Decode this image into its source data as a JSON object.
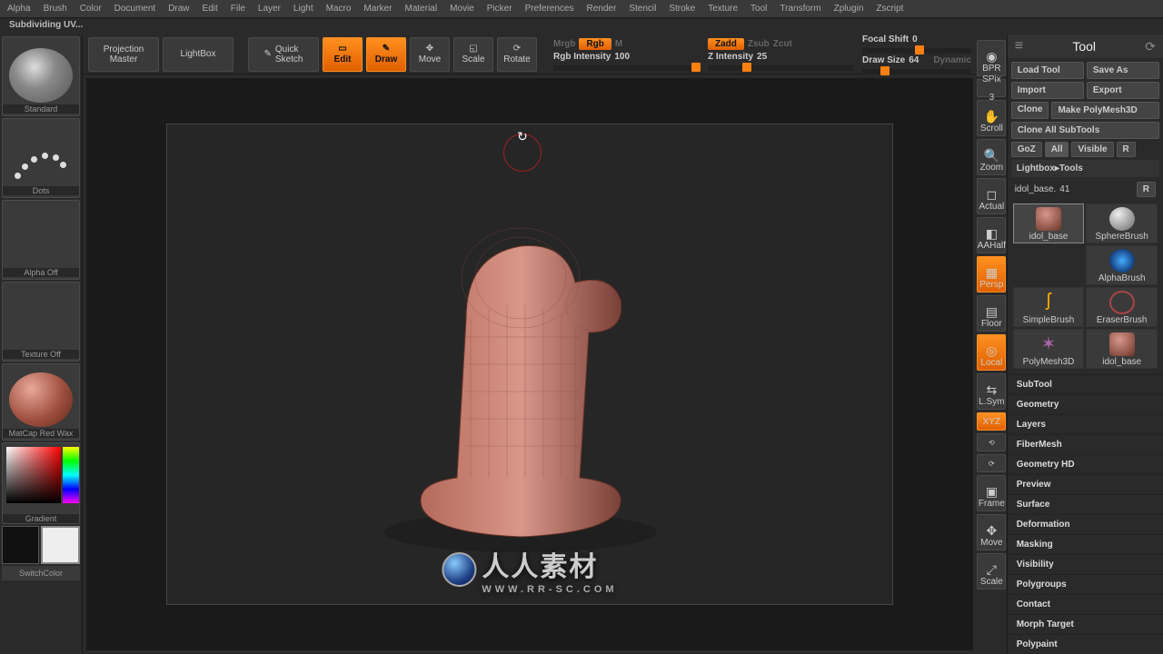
{
  "menu": [
    "Alpha",
    "Brush",
    "Color",
    "Document",
    "Draw",
    "Edit",
    "File",
    "Layer",
    "Light",
    "Macro",
    "Marker",
    "Material",
    "Movie",
    "Picker",
    "Preferences",
    "Render",
    "Stencil",
    "Stroke",
    "Texture",
    "Tool",
    "Transform",
    "Zplugin",
    "Zscript"
  ],
  "status_line": "Subdividing UV...",
  "top_btns": {
    "projection": "Projection\nMaster",
    "lightbox": "LightBox",
    "quicksketch": "Quick\nSketch"
  },
  "mode_btns": {
    "edit": "Edit",
    "draw": "Draw",
    "move": "Move",
    "scale": "Scale",
    "rotate": "Rotate"
  },
  "sliders": {
    "mrgb": "Mrgb",
    "rgb": "Rgb",
    "m": "M",
    "rgb_int_label": "Rgb Intensity",
    "rgb_int_val": "100",
    "zadd": "Zadd",
    "zsub": "Zsub",
    "zcut": "Zcut",
    "z_int_label": "Z Intensity",
    "z_int_val": "25",
    "focal_label": "Focal Shift",
    "focal_val": "0",
    "draw_label": "Draw Size",
    "draw_val": "64",
    "dynamic": "Dynamic"
  },
  "left": {
    "brush": "Standard",
    "stroke": "Dots",
    "alpha": "Alpha Off",
    "texture": "Texture Off",
    "material": "MatCap Red Wax",
    "gradient": "Gradient",
    "switchcolor": "SwitchColor"
  },
  "side": {
    "bpr": "BPR",
    "spix_label": "SPix",
    "spix_val": "3",
    "scroll": "Scroll",
    "zoom": "Zoom",
    "actual": "Actual",
    "aahalf": "AAHalf",
    "persp": "Persp",
    "floor": "Floor",
    "local": "Local",
    "lsym": "L.Sym",
    "xyz": "XYZ",
    "frame": "Frame",
    "move": "Move",
    "scale": "Scale"
  },
  "tool_panel": {
    "title": "Tool",
    "load": "Load Tool",
    "saveas": "Save As",
    "import": "Import",
    "export": "Export",
    "clone": "Clone",
    "makepoly": "Make PolyMesh3D",
    "cloneall": "Clone All SubTools",
    "goz": "GoZ",
    "all": "All",
    "visible": "Visible",
    "r": "R",
    "breadcrumb": "Lightbox▸Tools",
    "current": "idol_base.",
    "current_num": "41",
    "thumbs": [
      "idol_base",
      "SphereBrush",
      "AlphaBrush",
      "SimpleBrush",
      "EraserBrush",
      "PolyMesh3D",
      "idol_base"
    ],
    "sections": [
      "SubTool",
      "Geometry",
      "Layers",
      "FiberMesh",
      "Geometry HD",
      "Preview",
      "Surface",
      "Deformation",
      "Masking",
      "Visibility",
      "Polygroups",
      "Contact",
      "Morph Target",
      "Polypaint"
    ]
  },
  "watermark": {
    "text_cn": "人人素材",
    "text_url": "WWW.RR-SC.COM"
  }
}
